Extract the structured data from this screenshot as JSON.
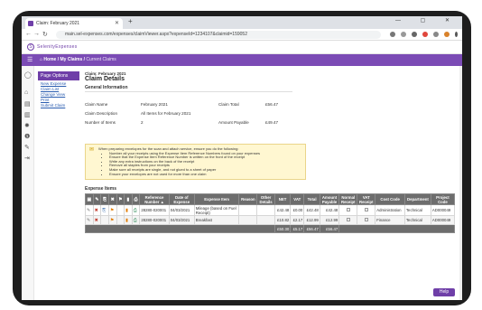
{
  "browser": {
    "tab_title": "Claim: February 2021",
    "new_tab": "+",
    "window_controls": "—  ▢  ✕",
    "url": "main.sel-expenses.com/expenses/claimViewer.aspx?expenseId=1234107&claimid=159052"
  },
  "app": {
    "logo_text": "SelenityExpenses",
    "breadcrumb_home": "Home",
    "breadcrumb_claims": "My Claims",
    "breadcrumb_current": "Current Claims",
    "help_label": "Help"
  },
  "page_options": {
    "header": "Page Options",
    "links": [
      "New Expense",
      "Claim List",
      "Change View",
      "Print",
      "Submit Claim"
    ]
  },
  "claim": {
    "small_title": "Claim: February 2021",
    "big_title": "Claim Details",
    "general_info": "General Information",
    "name_label": "Claim Name",
    "name_value": "February 2021",
    "desc_label": "Claim Description",
    "desc_value": "All Items for February 2021",
    "items_label": "Number of Items",
    "items_value": "2",
    "total_label": "Claim Total",
    "total_value": "£56.47",
    "payable_label": "Amount Payable",
    "payable_value": "£49.47"
  },
  "notice": {
    "intro": "When preparing envelopes for the scan and attach service, ensure you do the following:",
    "items": [
      "Number all your receipts using the Expense Item Reference Numbers found on your expenses",
      "Ensure that the Expense Item Reference Number is written on the front of the receipt",
      "Write any extra instructions on the back of the receipt",
      "Remove all staples from your receipts",
      "Make sure all receipts are single, and not glued to a sheet of paper",
      "Ensure your envelopes are not used for more than one claim"
    ]
  },
  "expense_items": {
    "header": "Expense Items",
    "columns": [
      "Reference Number ▲",
      "Date of Expense",
      "Expense Item",
      "Reason",
      "Other Details",
      "NET",
      "VAT",
      "Total",
      "Amount Payable",
      "Normal Receipt",
      "VAT Receipt",
      "Cost Code",
      "Department",
      "Project Code"
    ],
    "rows": [
      {
        "ref": "28280-020001",
        "date": "04/03/2021",
        "item": "Mileage (based on Fuel Receipt)",
        "reason": "",
        "other": "",
        "net": "£42.48",
        "vat": "£0.00",
        "total": "£42.48",
        "payable": "£42.48",
        "cost_code": "Administration",
        "department": "Technical",
        "project": "AD000049"
      },
      {
        "ref": "28280-020001",
        "date": "04/03/2021",
        "item": "Breakfast",
        "reason": "",
        "other": "",
        "net": "£10.82",
        "vat": "£2.17",
        "total": "£12.99",
        "payable": "£12.99",
        "cost_code": "Finance",
        "department": "Technical",
        "project": "AD000049"
      }
    ],
    "totals": {
      "net": "£50.30",
      "vat": "£5.17",
      "total": "£56.47",
      "payable": "£56.47"
    }
  }
}
